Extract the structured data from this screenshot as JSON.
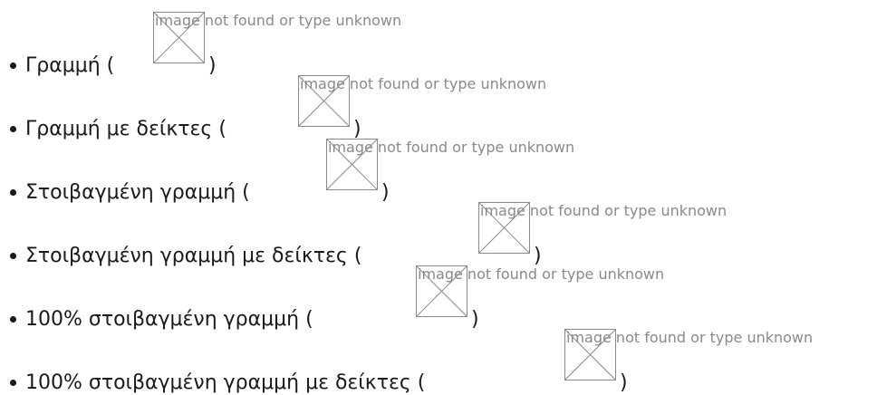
{
  "list_items": [
    {
      "label": "Γραμμή (",
      "alt": "image not found or type unknown",
      "close": ")"
    },
    {
      "label": "Γραμμή με δείκτες (",
      "alt": "image not found or type unknown",
      "close": ")"
    },
    {
      "label": "Στοιβαγμένη γραμμή (",
      "alt": "image not found or type unknown",
      "close": ")"
    },
    {
      "label": "Στοιβαγμένη γραμμή με δείκτες (",
      "alt": "image not found or type unknown",
      "close": ")"
    },
    {
      "label": "100% στοιβαγμένη γραμμή (",
      "alt": "image not found or type unknown",
      "close": ")"
    },
    {
      "label": "100% στοιβαγμένη γραμμή με δείκτες (",
      "alt": "image not found or type unknown",
      "close": ")"
    }
  ]
}
